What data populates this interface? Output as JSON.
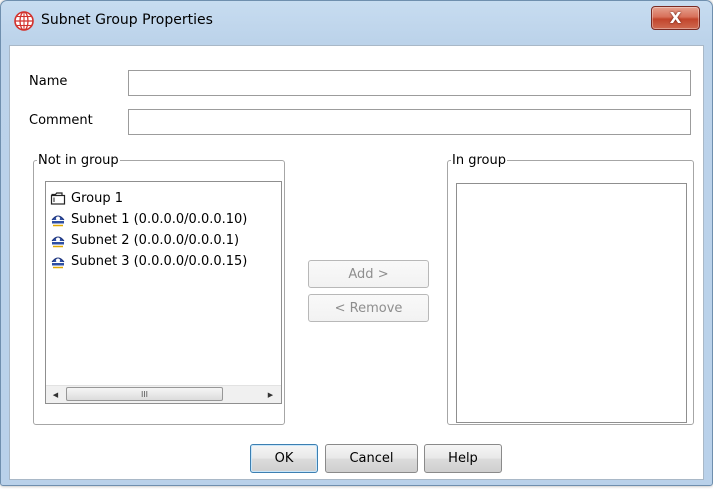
{
  "window": {
    "title": "Subnet Group Properties",
    "close_glyph": "X"
  },
  "form": {
    "name_label": "Name",
    "name_value": "",
    "comment_label": "Comment",
    "comment_value": ""
  },
  "not_in_group": {
    "legend": "Not in group",
    "items": [
      {
        "label": "Group 1",
        "icon": "folder-icon"
      },
      {
        "label": "Subnet 1 (0.0.0.0/0.0.0.10)",
        "icon": "subnet-icon"
      },
      {
        "label": "Subnet 2 (0.0.0.0/0.0.0.1)",
        "icon": "subnet-icon"
      },
      {
        "label": "Subnet 3 (0.0.0.0/0.0.0.15)",
        "icon": "subnet-icon"
      }
    ],
    "scroll_left": "◀",
    "scroll_right": "▶",
    "scroll_grip": "III"
  },
  "in_group": {
    "legend": "In group",
    "items": []
  },
  "actions": {
    "add_label": "Add >",
    "remove_label": "< Remove"
  },
  "footer": {
    "ok_label": "OK",
    "cancel_label": "Cancel",
    "help_label": "Help"
  },
  "colors": {
    "subnet_icon": "#2f4fa3",
    "close_button": "#c7452c",
    "app_icon": "#d2322d"
  }
}
